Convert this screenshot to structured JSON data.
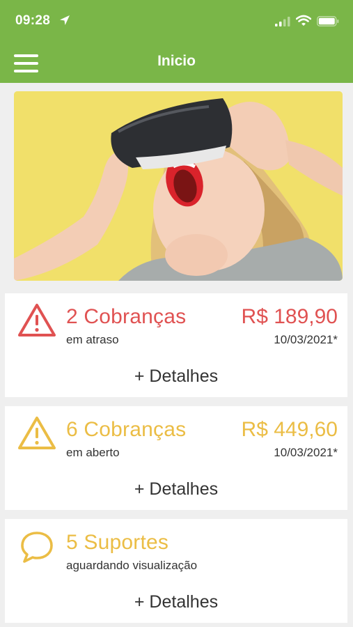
{
  "status_bar": {
    "time": "09:28"
  },
  "header": {
    "title": "Inicio"
  },
  "colors": {
    "header_green": "#7ab648",
    "alert_red": "#e05252",
    "warning_yellow": "#ebbd45"
  },
  "banner": {
    "image": "woman-vr-headset-photo"
  },
  "cards": [
    {
      "icon": "warning-triangle-icon",
      "count_label": "2 Cobranças",
      "status": "em atraso",
      "amount": "R$ 189,90",
      "date": "10/03/2021*",
      "details": "+ Detalhes"
    },
    {
      "icon": "warning-triangle-icon",
      "count_label": "6 Cobranças",
      "status": "em aberto",
      "amount": "R$ 449,60",
      "date": "10/03/2021*",
      "details": "+ Detalhes"
    },
    {
      "icon": "chat-bubble-icon",
      "count_label": "5 Suportes",
      "status": "aguardando visualização",
      "details": "+ Detalhes"
    }
  ]
}
